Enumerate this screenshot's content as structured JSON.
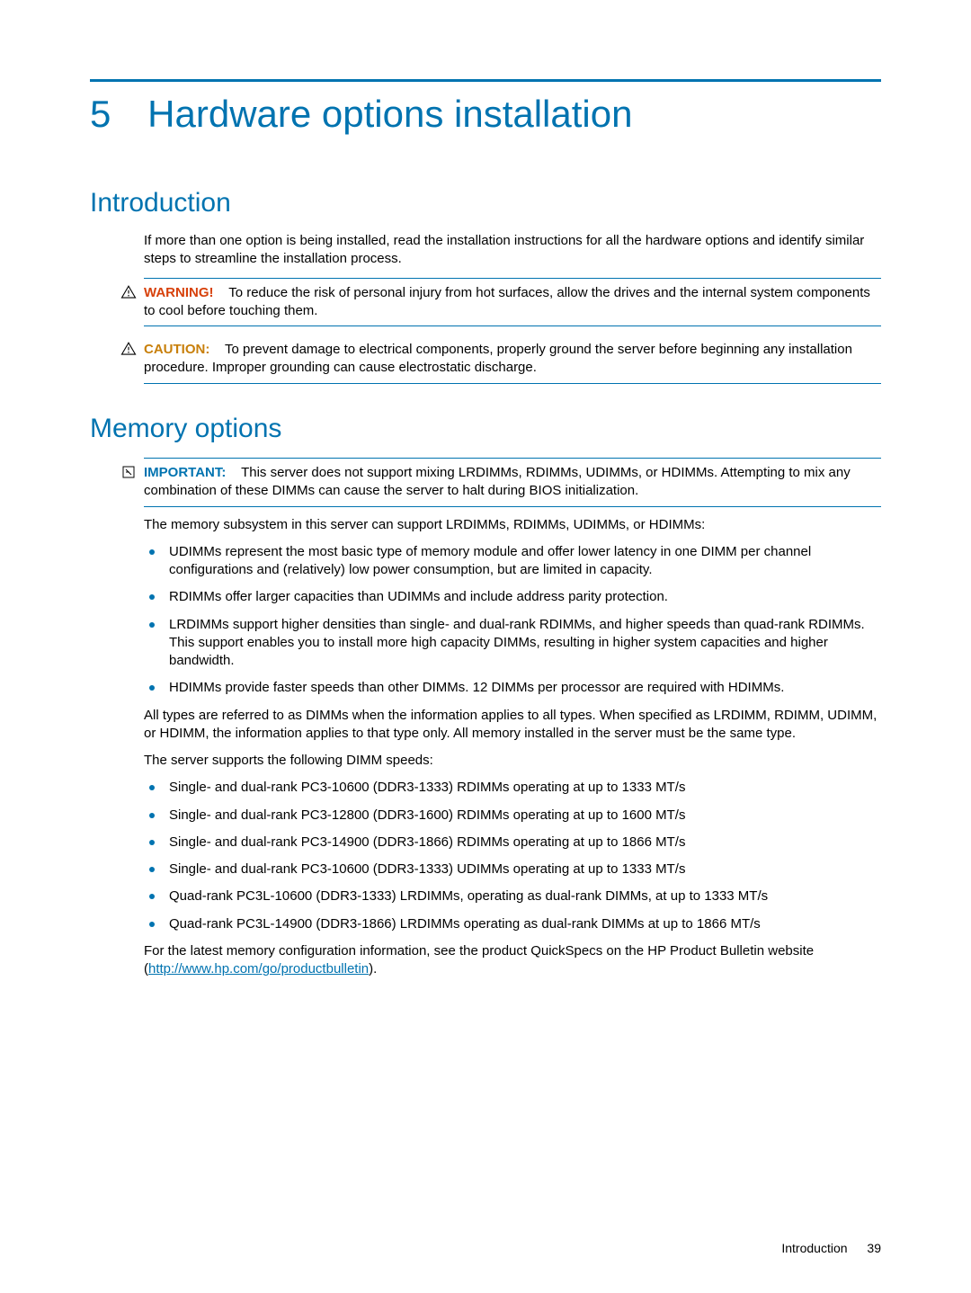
{
  "chapter": {
    "num": "5",
    "title": "Hardware options installation"
  },
  "intro": {
    "heading": "Introduction",
    "p1": "If more than one option is being installed, read the installation instructions for all the hardware options and identify similar steps to streamline the installation process.",
    "warn": {
      "label": "WARNING!",
      "text": "To reduce the risk of personal injury from hot surfaces, allow the drives and the internal system components to cool before touching them."
    },
    "caut": {
      "label": "CAUTION:",
      "text": "To prevent damage to electrical components, properly ground the server before beginning any installation procedure. Improper grounding can cause electrostatic discharge."
    }
  },
  "mem": {
    "heading": "Memory options",
    "imp": {
      "label": "IMPORTANT:",
      "text": "This server does not support mixing LRDIMMs, RDIMMs, UDIMMs, or HDIMMs. Attempting to mix any combination of these DIMMs can cause the server to halt during BIOS initialization."
    },
    "p1": "The memory subsystem in this server can support LRDIMMs, RDIMMs, UDIMMs, or HDIMMs:",
    "types": [
      "UDIMMs represent the most basic type of memory module and offer lower latency in one DIMM per channel configurations and (relatively) low power consumption, but are limited in capacity.",
      "RDIMMs offer larger capacities than UDIMMs and include address parity protection.",
      "LRDIMMs support higher densities than single- and dual-rank RDIMMs, and higher speeds than quad-rank RDIMMs. This support enables you to install more high capacity DIMMs, resulting in higher system capacities and higher bandwidth.",
      "HDIMMs provide faster speeds than other DIMMs. 12 DIMMs per processor are required with HDIMMs."
    ],
    "p2": "All types are referred to as DIMMs when the information applies to all types. When specified as LRDIMM, RDIMM, UDIMM, or HDIMM, the information applies to that type only. All memory installed in the server must be the same type.",
    "p3": "The server supports the following DIMM speeds:",
    "speeds": [
      "Single- and dual-rank PC3-10600 (DDR3-1333) RDIMMs operating at up to 1333 MT/s",
      "Single- and dual-rank PC3-12800 (DDR3-1600) RDIMMs operating at up to 1600 MT/s",
      "Single- and dual-rank PC3-14900 (DDR3-1866) RDIMMs operating at up to 1866 MT/s",
      "Single- and dual-rank PC3-10600 (DDR3-1333) UDIMMs operating at up to 1333 MT/s",
      "Quad-rank PC3L-10600 (DDR3-1333) LRDIMMs, operating as dual-rank DIMMs, at up to 1333 MT/s",
      "Quad-rank PC3L-14900 (DDR3-1866) LRDIMMs operating as dual-rank DIMMs at up to 1866 MT/s"
    ],
    "p4a": "For the latest memory configuration information, see the product QuickSpecs on the HP Product Bulletin website (",
    "link": "http://www.hp.com/go/productbulletin",
    "p4b": ")."
  },
  "footer": {
    "section": "Introduction",
    "page": "39"
  }
}
